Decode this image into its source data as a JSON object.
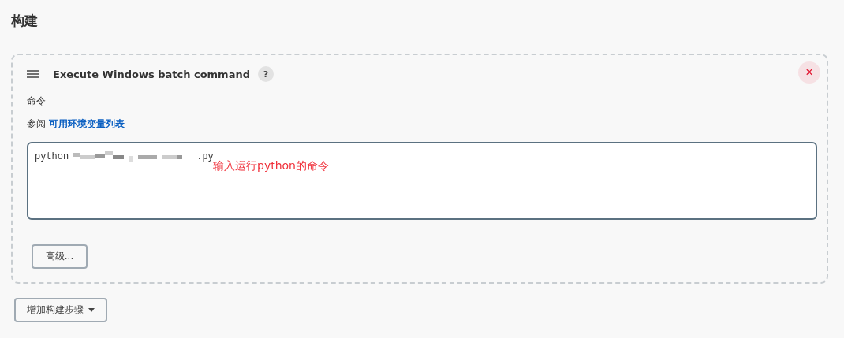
{
  "section_title": "构建",
  "build_step": {
    "title": "Execute Windows batch command",
    "help": "?",
    "close": "×",
    "field_label": "命令",
    "see_also": {
      "prefix": "参阅",
      "link": "可用环境变量列表"
    },
    "command": {
      "before": "python",
      "after": ".py"
    },
    "annotation": "输入运行python的命令",
    "advanced_button": "高级..."
  },
  "add_step_button": "增加构建步骤"
}
